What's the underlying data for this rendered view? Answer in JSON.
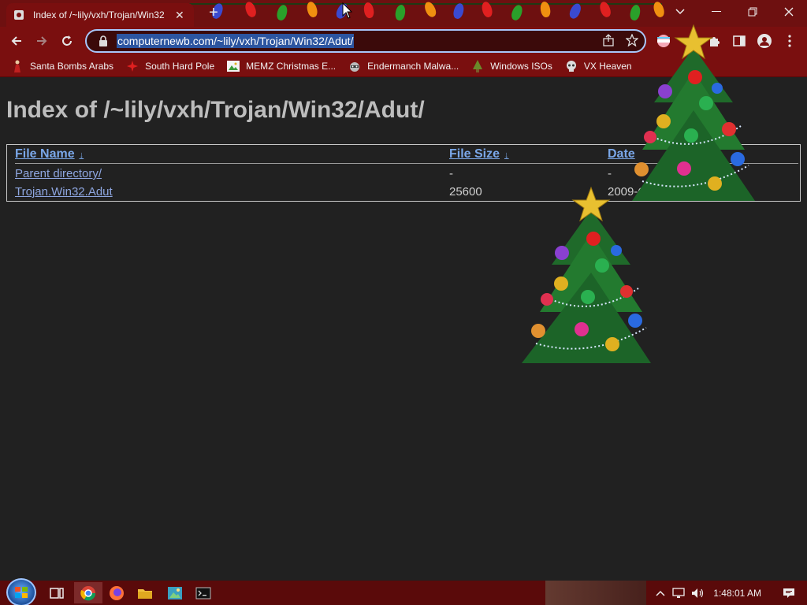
{
  "browser": {
    "tab_title": "Index of /~lily/vxh/Trojan/Win32",
    "tab_close": "✕",
    "new_tab": "+",
    "url": "computernewb.com/~lily/vxh/Trojan/Win32/Adut/"
  },
  "bookmarks": [
    {
      "label": "Santa Bombs Arabs",
      "icon": "person-icon"
    },
    {
      "label": "South Hard Pole",
      "icon": "red-star-icon"
    },
    {
      "label": "MEMZ Christmas E...",
      "icon": "image-icon"
    },
    {
      "label": "Endermanch Malwa...",
      "icon": "raccoon-icon"
    },
    {
      "label": "Windows ISOs",
      "icon": "tree-icon"
    },
    {
      "label": "VX Heaven",
      "icon": "skull-icon"
    }
  ],
  "page": {
    "title": "Index of /~lily/vxh/Trojan/Win32/Adut/",
    "columns": {
      "name": "File Name",
      "size": "File Size",
      "date": "Date",
      "sort_arrow": "↓"
    },
    "rows": [
      {
        "name": "Parent directory/",
        "size": "-",
        "date": "-"
      },
      {
        "name": "Trojan.Win32.Adut",
        "size": "25600",
        "date": "2009-Oct-21"
      }
    ]
  },
  "taskbar": {
    "clock": "1:48:01 AM"
  },
  "colors": {
    "chrome_dark": "#6e1010",
    "chrome": "#7a0f0f",
    "page_bg": "#212121",
    "link": "#8ea6e0",
    "header_link": "#7aa7e8",
    "taskbar": "#5a0a0a"
  }
}
